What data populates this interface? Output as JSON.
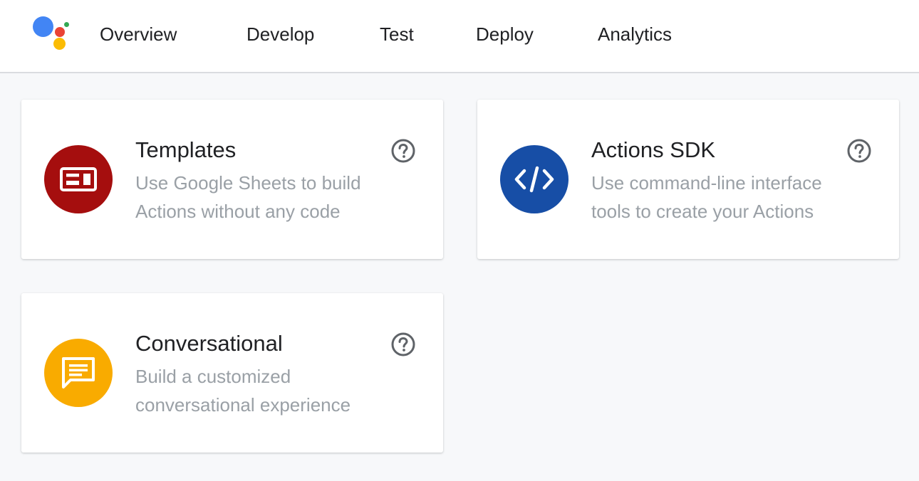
{
  "nav": {
    "items": [
      {
        "label": "Overview"
      },
      {
        "label": "Develop"
      },
      {
        "label": "Test"
      },
      {
        "label": "Deploy"
      },
      {
        "label": "Analytics"
      }
    ]
  },
  "cards": [
    {
      "title": "Templates",
      "description": "Use Google Sheets to build Actions without any code",
      "icon": "templates-icon",
      "color": "#a50e0e"
    },
    {
      "title": "Actions SDK",
      "description": "Use command-line interface tools to create your Actions",
      "icon": "code-icon",
      "color": "#174ea6"
    },
    {
      "title": "Conversational",
      "description": "Build a customized conversational experience",
      "icon": "chat-icon",
      "color": "#f9ab00"
    }
  ],
  "colors": {
    "logo_blue": "#4285f4",
    "logo_red": "#ea4335",
    "logo_yellow": "#fbbc04",
    "logo_green": "#34a853",
    "help_icon": "#5f6368"
  },
  "icons": {
    "logo": "google-assistant-logo-icon",
    "help": "help-circle-icon"
  }
}
